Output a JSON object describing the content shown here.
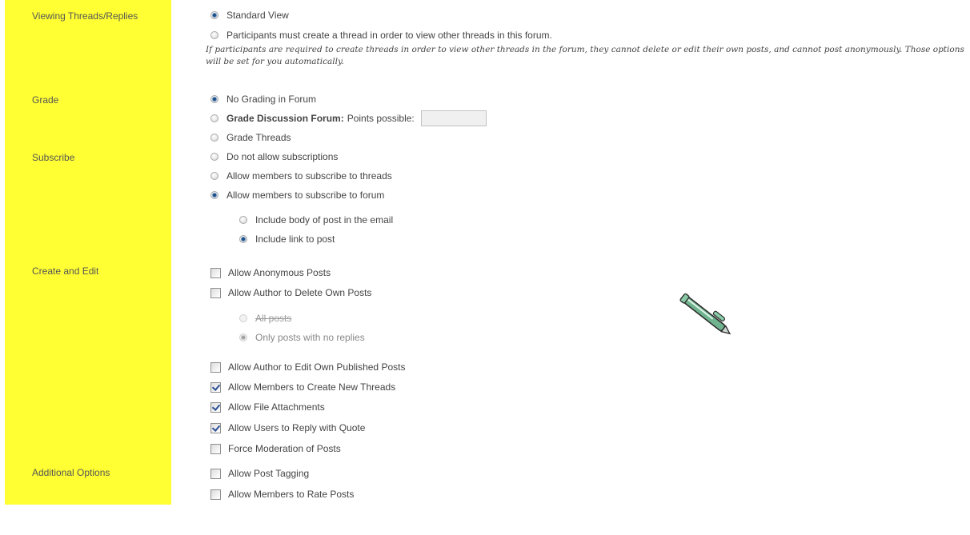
{
  "sections": {
    "viewing": "Viewing Threads/Replies",
    "grade": "Grade",
    "subscribe": "Subscribe",
    "create_edit": "Create and Edit",
    "additional": "Additional Options"
  },
  "viewing": {
    "standard": "Standard View",
    "participants": "Participants must create a thread in order to view other threads in this forum.",
    "note": "If participants are required to create threads in order to view other threads in the forum, they cannot delete or edit their own posts, and cannot post anonymously. Those options will be set for you automatically."
  },
  "grade": {
    "no_grading": "No Grading in Forum",
    "discussion_bold": "Grade Discussion Forum:",
    "points_possible": "Points possible:",
    "points_value": "",
    "threads": "Grade Threads"
  },
  "subscribe": {
    "none": "Do not allow subscriptions",
    "threads": "Allow members to subscribe to threads",
    "forum": "Allow members to subscribe to forum",
    "include_body": "Include body of post in the email",
    "include_link": "Include link to post"
  },
  "create_edit": {
    "anonymous": "Allow Anonymous Posts",
    "delete_own": "Allow Author to Delete Own Posts",
    "all_posts": "All posts",
    "only_no_replies": "Only posts with no replies",
    "edit_own": "Allow Author to Edit Own Published Posts",
    "new_threads": "Allow Members to Create New Threads",
    "file_attachments": "Allow File Attachments",
    "reply_quote": "Allow Users to Reply with Quote",
    "force_moderation": "Force Moderation of Posts"
  },
  "additional": {
    "tagging": "Allow Post Tagging",
    "rate_posts": "Allow Members to Rate Posts"
  },
  "state": {
    "viewing_selected": "standard",
    "grade_selected": "no_grading",
    "subscribe_selected": "forum",
    "subscribe_option_selected": "include_link",
    "delete_option_selected": "only_no_replies",
    "anonymous": false,
    "delete_own": false,
    "edit_own": false,
    "new_threads": true,
    "file_attachments": true,
    "reply_quote": true,
    "force_moderation": false,
    "tagging": false,
    "rate_posts": false
  },
  "colors": {
    "sidebar": "#ffff33",
    "label_text": "#555555",
    "radio_selected": "#1f4f86",
    "checkmark": "#2b4f95"
  },
  "icons": {
    "pen": "pen-icon"
  }
}
